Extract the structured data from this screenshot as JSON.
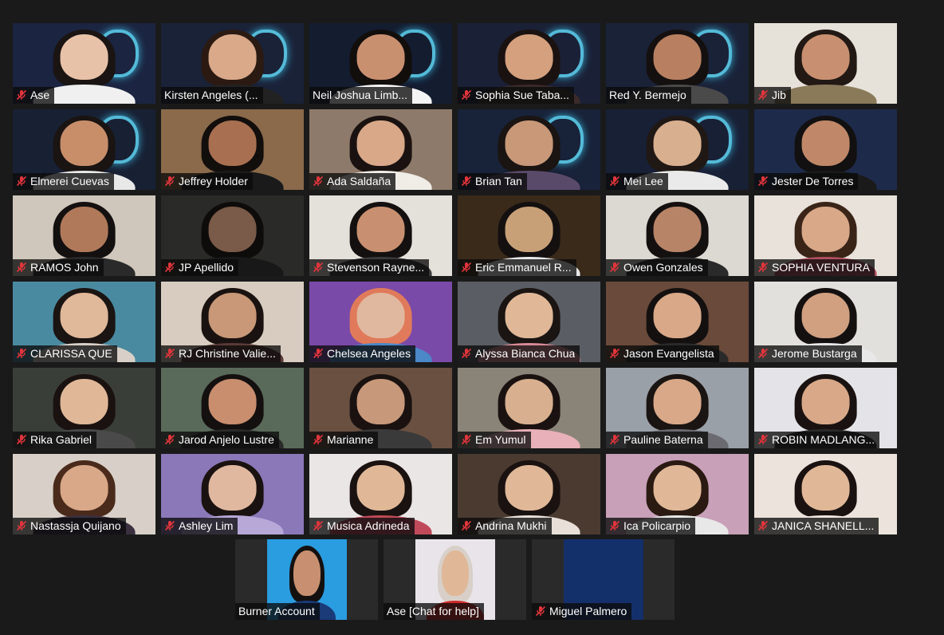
{
  "participants": [
    {
      "name": "Ase",
      "muted": true,
      "bg": "#1b2440",
      "skin": "#e8c2a8",
      "hair": "#1a1412",
      "shirt": "#f0f0f0",
      "brand": true
    },
    {
      "name": "Kirsten Angeles (...",
      "muted": false,
      "bg": "#1a2238",
      "skin": "#d9a98a",
      "hair": "#2a1a12",
      "shirt": "#222",
      "brand": true,
      "active": true
    },
    {
      "name": "Neil Joshua Limb...",
      "muted": false,
      "bg": "#141c30",
      "skin": "#c99070",
      "hair": "#120e0c",
      "shirt": "#f4f4f4",
      "brand": true
    },
    {
      "name": "Sophia Sue Taba...",
      "muted": true,
      "bg": "#1a2036",
      "skin": "#d4a07e",
      "hair": "#1a1210",
      "shirt": "#3a2a2a",
      "brand": true
    },
    {
      "name": "Red Y. Bermejo",
      "muted": false,
      "bg": "#1a2238",
      "skin": "#b88060",
      "hair": "#151010",
      "shirt": "#4a4a4a",
      "brand": true
    },
    {
      "name": "Jib",
      "muted": true,
      "bg": "#e6e2da",
      "skin": "#c89070",
      "hair": "#221814",
      "shirt": "#8a7a5a",
      "brand": false
    },
    {
      "name": "Elmerei Cuevas",
      "muted": true,
      "bg": "#182034",
      "skin": "#c88e6a",
      "hair": "#1a1412",
      "shirt": "#e8e8e8",
      "brand": true
    },
    {
      "name": "Jeffrey Holder",
      "muted": true,
      "bg": "#8a6a4a",
      "skin": "#a87050",
      "hair": "#120e0c",
      "shirt": "#1a1a1a",
      "brand": false
    },
    {
      "name": "Ada Saldaña",
      "muted": true,
      "bg": "#8e7a6a",
      "skin": "#d8a888",
      "hair": "#1a1210",
      "shirt": "#f0ece6",
      "brand": false
    },
    {
      "name": "Brian Tan",
      "muted": true,
      "bg": "#182238",
      "skin": "#c89878",
      "hair": "#1a1412",
      "shirt": "#5a4a6a",
      "brand": true
    },
    {
      "name": "Mei Lee",
      "muted": true,
      "bg": "#182036",
      "skin": "#d8b090",
      "hair": "#201814",
      "shirt": "#eaeaea",
      "brand": true
    },
    {
      "name": "Jester De Torres",
      "muted": true,
      "bg": "#1e2a4a",
      "skin": "#c08868",
      "hair": "#121010",
      "shirt": "#1a1a1a",
      "brand": false
    },
    {
      "name": "RAMOS John",
      "muted": true,
      "bg": "#cfc7bb",
      "skin": "#b07a5a",
      "hair": "#141010",
      "shirt": "#2a2a2a",
      "brand": false
    },
    {
      "name": "JP Apellido",
      "muted": true,
      "bg": "#2a2a28",
      "skin": "#7a5a48",
      "hair": "#0e0c0a",
      "shirt": "#181818",
      "brand": false
    },
    {
      "name": "Stevenson Rayne...",
      "muted": true,
      "bg": "#e4e0da",
      "skin": "#c89070",
      "hair": "#141010",
      "shirt": "#3a3a3a",
      "brand": false
    },
    {
      "name": "Eric Emmanuel R...",
      "muted": true,
      "bg": "#3a2a1a",
      "skin": "#c8a078",
      "hair": "#141010",
      "shirt": "#e8e8ea",
      "brand": false
    },
    {
      "name": "Owen Gonzales",
      "muted": true,
      "bg": "#dcd8d2",
      "skin": "#b88468",
      "hair": "#141010",
      "shirt": "#2a2a2a",
      "brand": false
    },
    {
      "name": "SOPHIA VENTURA",
      "muted": true,
      "bg": "#e8e2da",
      "skin": "#d8a888",
      "hair": "#3a2418",
      "shirt": "#b05060",
      "brand": false
    },
    {
      "name": "CLARISSA QUE",
      "muted": true,
      "bg": "#4a8aa0",
      "skin": "#e0b89a",
      "hair": "#1a1412",
      "shirt": "#d8d0c8",
      "brand": false
    },
    {
      "name": "RJ Christine Valie...",
      "muted": true,
      "bg": "#d8ccc0",
      "skin": "#c89878",
      "hair": "#1a1210",
      "shirt": "#5a3a3a",
      "brand": false
    },
    {
      "name": "Chelsea Angeles",
      "muted": true,
      "bg": "#7a4aa8",
      "skin": "#e0b8a0",
      "hair": "#e07a5a",
      "shirt": "#4a88c8",
      "brand": false
    },
    {
      "name": "Alyssa Bianca Chua",
      "muted": true,
      "bg": "#5a5e64",
      "skin": "#e0b898",
      "hair": "#1a1412",
      "shirt": "#d88a98",
      "brand": false
    },
    {
      "name": "Jason Evangelista",
      "muted": true,
      "bg": "#6a4a3a",
      "skin": "#d8a888",
      "hair": "#141010",
      "shirt": "#2a2a2a",
      "brand": false
    },
    {
      "name": "Jerome Bustarga",
      "muted": true,
      "bg": "#e2e0dc",
      "skin": "#d0a080",
      "hair": "#141010",
      "shirt": "#e8e8e8",
      "brand": false
    },
    {
      "name": "Rika Gabriel",
      "muted": true,
      "bg": "#3a3e38",
      "skin": "#e0b898",
      "hair": "#1a1210",
      "shirt": "#4a4a4a",
      "brand": false
    },
    {
      "name": "Jarod Anjelo Lustre",
      "muted": true,
      "bg": "#5a6a5a",
      "skin": "#c88e6e",
      "hair": "#141010",
      "shirt": "#2a2a2a",
      "brand": false
    },
    {
      "name": "Marianne",
      "muted": true,
      "bg": "#6a5040",
      "skin": "#c8987a",
      "hair": "#1a1210",
      "shirt": "#3a3a3a",
      "brand": false
    },
    {
      "name": "Em Yumul",
      "muted": true,
      "bg": "#8a8478",
      "skin": "#d8b090",
      "hair": "#1a1210",
      "shirt": "#e8b0b8",
      "brand": false
    },
    {
      "name": "Pauline Baterna",
      "muted": true,
      "bg": "#9aa0a8",
      "skin": "#d8a888",
      "hair": "#1a1412",
      "shirt": "#6a6a70",
      "brand": false
    },
    {
      "name": "ROBIN MADLANG...",
      "muted": true,
      "bg": "#e4e4e8",
      "skin": "#d8a888",
      "hair": "#1a1210",
      "shirt": "#2a2a2a",
      "brand": false
    },
    {
      "name": "Nastassja Quijano",
      "muted": true,
      "bg": "#d8d0c8",
      "skin": "#d8a888",
      "hair": "#4a2a1a",
      "shirt": "#3a3040",
      "brand": false
    },
    {
      "name": "Ashley Lim",
      "muted": true,
      "bg": "#8a78b8",
      "skin": "#e0b8a0",
      "hair": "#1a1210",
      "shirt": "#b8a8d8",
      "brand": false
    },
    {
      "name": "Musica Adrineda",
      "muted": true,
      "bg": "#ebe6e6",
      "skin": "#e0b898",
      "hair": "#1a1210",
      "shirt": "#c04a5a",
      "brand": false
    },
    {
      "name": "Andrina Mukhi",
      "muted": true,
      "bg": "#4a3a30",
      "skin": "#e0b898",
      "hair": "#1a1210",
      "shirt": "#e8e0d8",
      "brand": false
    },
    {
      "name": "Ica Policarpio",
      "muted": true,
      "bg": "#c8a0b8",
      "skin": "#e0b898",
      "hair": "#2a1a12",
      "shirt": "#e8e8e8",
      "brand": false
    },
    {
      "name": "JANICA SHANELL...",
      "muted": true,
      "bg": "#ece4dc",
      "skin": "#e0b898",
      "hair": "#1a1210",
      "shirt": "#f0e8e0",
      "brand": false
    }
  ],
  "bottom": [
    {
      "name": "Burner Account",
      "muted": false,
      "bg": "#2a9ce0",
      "skin": "#c89070",
      "hair": "#141010",
      "shirt": "#1a3a78",
      "frame": "#2a2a2a"
    },
    {
      "name": "Ase [Chat for help]",
      "muted": false,
      "bg": "#e8e4ea",
      "skin": "#e0b898",
      "hair": "#d8d0c8",
      "shirt": "#d02a2a",
      "frame": "#2a2a2a"
    },
    {
      "name": "Miguel Palmero",
      "muted": true,
      "bg": "#14306a",
      "skin": null,
      "hair": null,
      "shirt": null,
      "frame": "#2a2a2a"
    }
  ],
  "icons": {
    "muted": "mic-muted-icon"
  },
  "colors": {
    "muted_icon": "#e0353b",
    "active_border": "#d8e07a",
    "nameplate_text": "#ffffff"
  }
}
